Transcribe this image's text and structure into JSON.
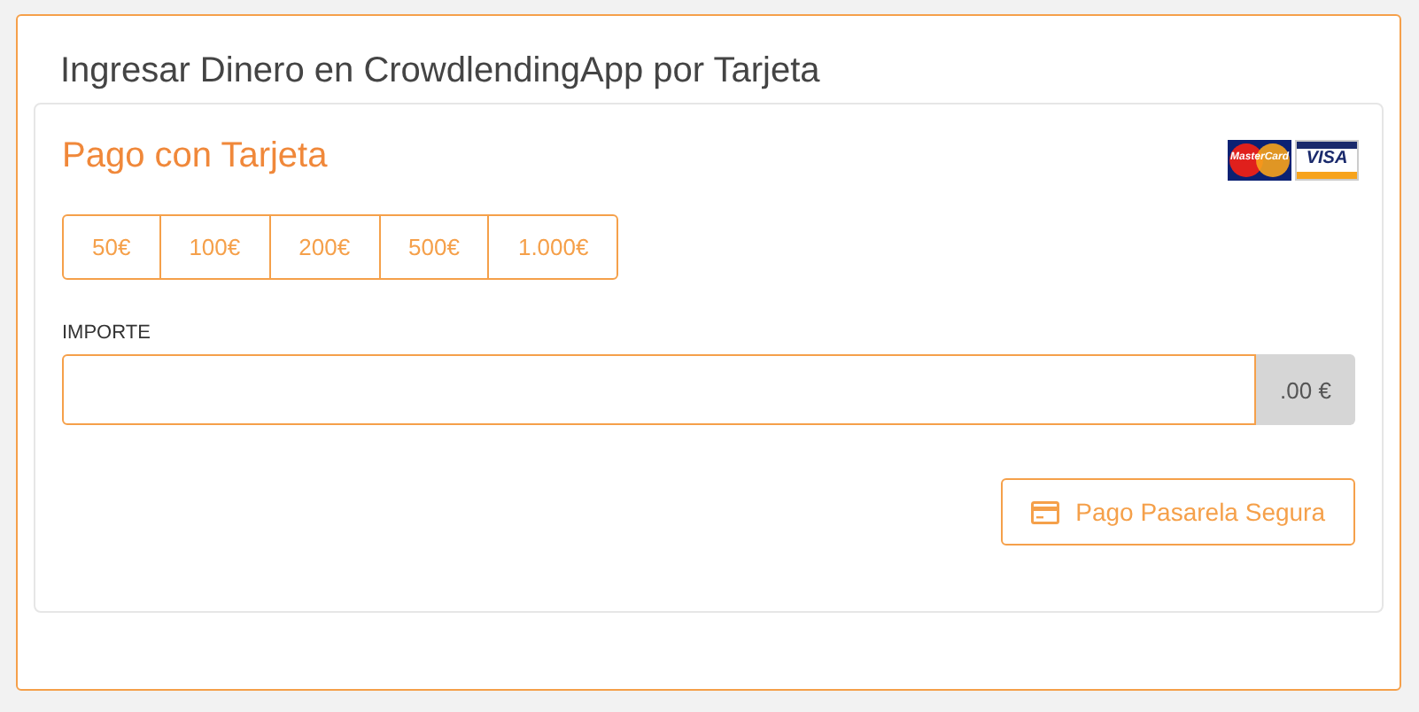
{
  "panel": {
    "title": "Ingresar Dinero en CrowdlendingApp por Tarjeta"
  },
  "card": {
    "title": "Pago con Tarjeta",
    "logos": [
      {
        "kind": "mastercard",
        "label": "MasterCard"
      },
      {
        "kind": "visa",
        "label": "VISA"
      }
    ],
    "amounts": [
      {
        "label": "50€",
        "selected": false
      },
      {
        "label": "100€",
        "selected": false
      },
      {
        "label": "200€",
        "selected": false
      },
      {
        "label": "500€",
        "selected": false
      },
      {
        "label": "1.000€",
        "selected": false
      }
    ],
    "amount_field": {
      "label": "IMPORTE",
      "suffix": ".00 €"
    },
    "pay_button": "Pago Pasarela Segura"
  }
}
